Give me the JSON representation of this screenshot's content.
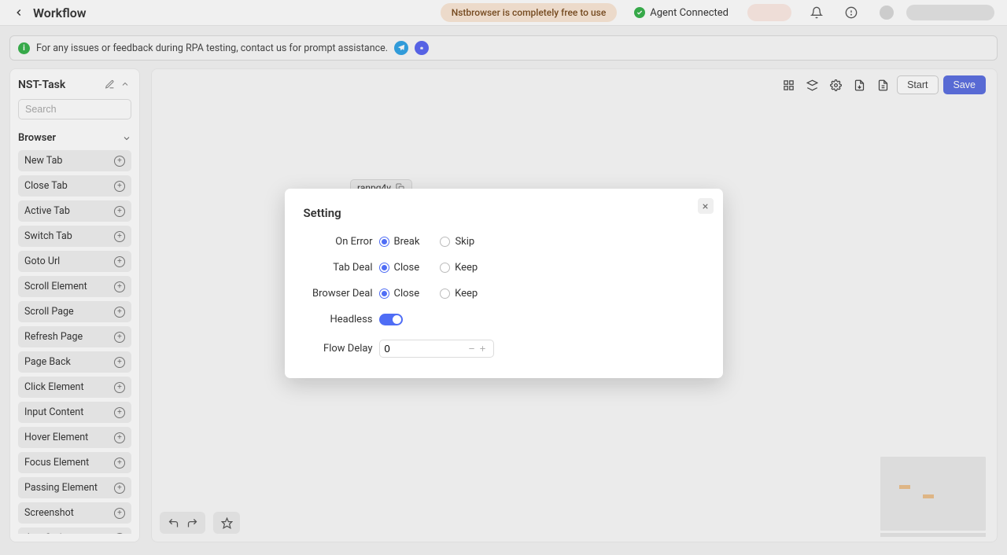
{
  "header": {
    "title": "Workflow",
    "free_badge": "Nstbrowser is completely free to use",
    "agent_status": "Agent Connected"
  },
  "notice": {
    "text": "For any issues or feedback during RPA testing, contact us for prompt assistance."
  },
  "sidebar": {
    "task_name": "NST-Task",
    "search_placeholder": "Search",
    "category": "Browser",
    "nodes": [
      "New Tab",
      "Close Tab",
      "Active Tab",
      "Switch Tab",
      "Goto Url",
      "Scroll Element",
      "Scroll Page",
      "Refresh Page",
      "Page Back",
      "Click Element",
      "Input Content",
      "Hover Element",
      "Focus Element",
      "Passing Element",
      "Screenshot",
      "JavaScript"
    ]
  },
  "canvas": {
    "node_tag": "ranpq4v",
    "start_button": "Start",
    "save_button": "Save"
  },
  "modal": {
    "title": "Setting",
    "on_error_label": "On Error",
    "on_error_options": [
      "Break",
      "Skip"
    ],
    "on_error_selected": "Break",
    "tab_deal_label": "Tab Deal",
    "tab_deal_options": [
      "Close",
      "Keep"
    ],
    "tab_deal_selected": "Close",
    "browser_deal_label": "Browser Deal",
    "browser_deal_options": [
      "Close",
      "Keep"
    ],
    "browser_deal_selected": "Close",
    "headless_label": "Headless",
    "headless_value": true,
    "flow_delay_label": "Flow Delay",
    "flow_delay_value": "0"
  }
}
